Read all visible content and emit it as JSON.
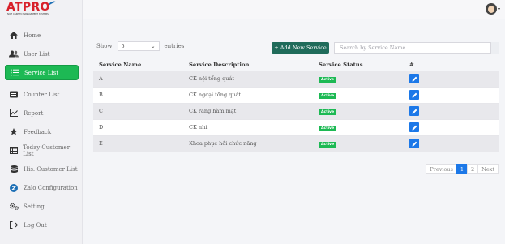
{
  "brand": {
    "logo": "ATPRO",
    "tagline": "NICE CARE TO MANAGEMENT SYSTEMS"
  },
  "sidebar": {
    "items": [
      {
        "label": "Home",
        "icon": "home-icon"
      },
      {
        "label": "User List",
        "icon": "users-icon"
      },
      {
        "label": "Service List",
        "icon": "list-icon",
        "active": true
      },
      {
        "label": "Counter List",
        "icon": "counter-icon"
      },
      {
        "label": "Report",
        "icon": "chart-icon"
      },
      {
        "label": "Feedback",
        "icon": "star-icon"
      },
      {
        "label": "Today Customer List",
        "icon": "table-icon"
      },
      {
        "label": "His. Customer List",
        "icon": "database-icon"
      },
      {
        "label": "Zalo Configuration",
        "icon": "zalo-icon"
      },
      {
        "label": "Setting",
        "icon": "gears-icon"
      },
      {
        "label": "Log Out",
        "icon": "logout-icon"
      }
    ]
  },
  "controls": {
    "show_label": "Show",
    "entries_value": "5",
    "entries_label": "entries",
    "add_button": "+ Add New Service",
    "search_placeholder": "Search by Service Name"
  },
  "table": {
    "columns": [
      "Service Name",
      "Service Description",
      "Service Status",
      "#"
    ],
    "rows": [
      {
        "name": "A",
        "description": "CK nội tổng quát",
        "status": "Active"
      },
      {
        "name": "B",
        "description": "CK ngoại tổng quát",
        "status": "Active"
      },
      {
        "name": "C",
        "description": "CK răng hàm mặt",
        "status": "Active"
      },
      {
        "name": "D",
        "description": "CK nhi",
        "status": "Active"
      },
      {
        "name": "E",
        "description": "Khoa phục hồi chức năng",
        "status": "Active"
      }
    ]
  },
  "pagination": {
    "previous": "Previous",
    "pages": [
      "1",
      "2"
    ],
    "current": "1",
    "next": "Next"
  },
  "colors": {
    "accent": "#1db954",
    "primary_blue": "#1c78e8",
    "add_button": "#1f6b5a",
    "brand_red": "#d8202a"
  }
}
